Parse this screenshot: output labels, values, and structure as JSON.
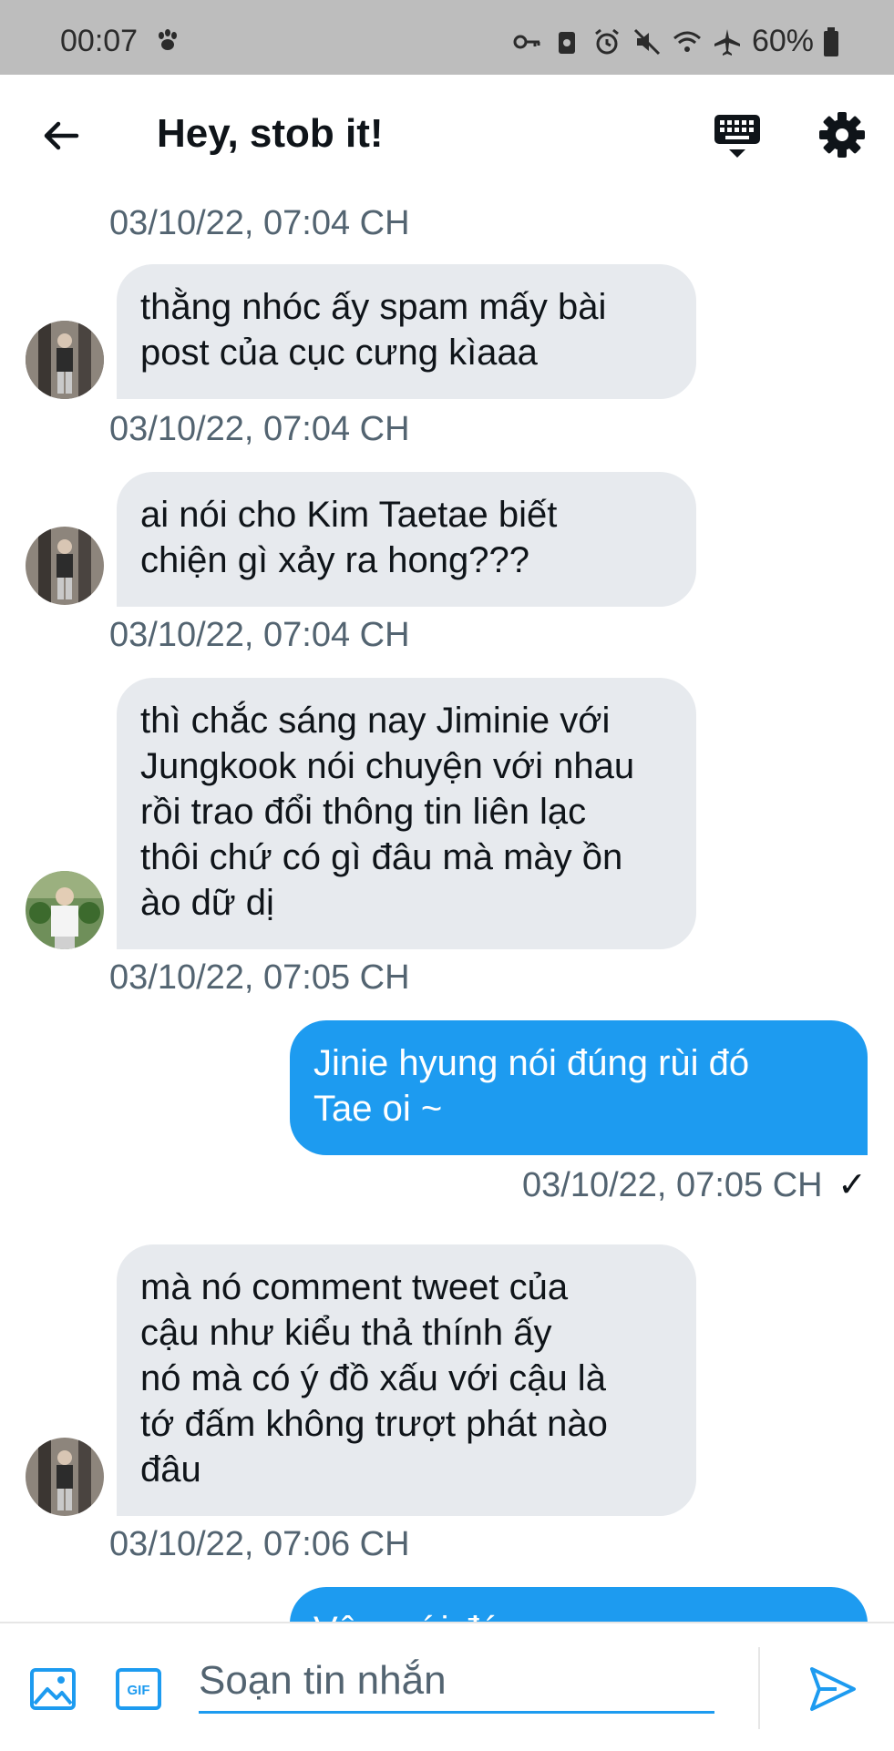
{
  "status_bar": {
    "time": "00:07",
    "battery": "60%"
  },
  "header": {
    "title": "Hey, stob it!"
  },
  "messages": [
    {
      "timestamp": "03/10/22, 07:04 CH"
    },
    {
      "text_lines": [
        "thằng nhóc ấy spam mấy bài",
        "post của cục cưng kìaaa"
      ],
      "timestamp": "03/10/22, 07:04 CH"
    },
    {
      "text_lines": [
        "ai nói cho Kim Taetae biết",
        "chiện gì xảy ra hong???"
      ],
      "timestamp": "03/10/22, 07:04 CH"
    },
    {
      "text_lines": [
        "thì chắc sáng nay Jiminie với",
        "Jungkook nói chuyện với nhau",
        "rồi trao đổi thông tin liên lạc",
        "thôi chứ có gì đâu mà mày ồn",
        "ào dữ dị"
      ],
      "timestamp": "03/10/22, 07:05 CH"
    },
    {
      "text_lines": [
        "Jinie hyung nói đúng rùi đó",
        "Tae oi ~"
      ],
      "timestamp": "03/10/22, 07:05 CH",
      "status": "✓"
    },
    {
      "text_lines": [
        "mà nó comment tweet của",
        "cậu như kiểu thả thính ấy",
        "nó mà có ý đồ xấu với cậu là",
        "tớ đấm không trượt phát nào",
        "đâu"
      ],
      "timestamp": "03/10/22, 07:06 CH"
    },
    {
      "text_lines": [
        "Vậy mới đúng",
        ""
      ]
    }
  ],
  "composer": {
    "placeholder": "Soạn tin nhắn",
    "gif_label": "GIF"
  },
  "colors": {
    "accent": "#1d9bf0",
    "incoming_bubble": "#e7eaee",
    "timestamp": "#536471",
    "status_bar": "#bdbdbd"
  }
}
